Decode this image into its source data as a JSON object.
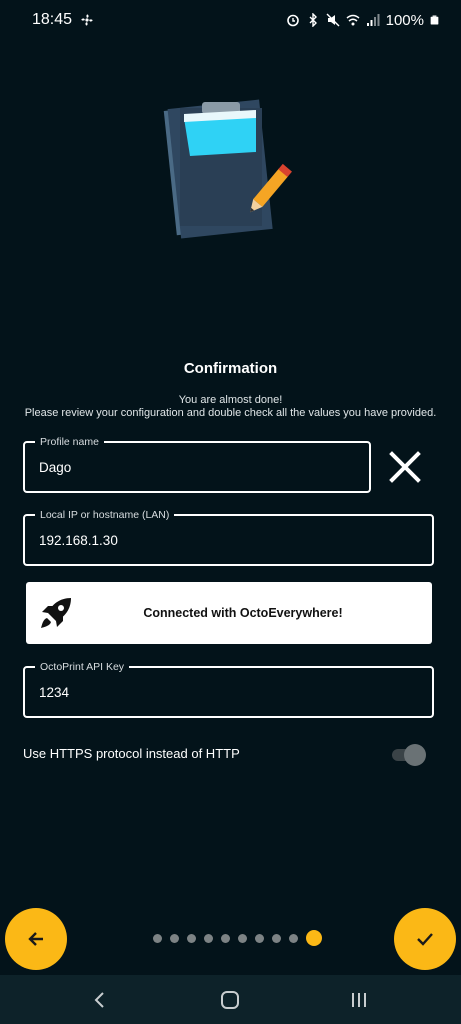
{
  "status_bar": {
    "time": "18:45",
    "battery": "100%",
    "icons": [
      "fan-icon",
      "alarm-icon",
      "bluetooth-icon",
      "mute-icon",
      "wifi-icon",
      "signal-icon",
      "battery-icon"
    ]
  },
  "header": {
    "title": "Confirmation",
    "subtitle_line1": "You are almost done!",
    "subtitle_line2": "Please review your configuration and double check all the values you have provided."
  },
  "form": {
    "profile_name": {
      "label": "Profile name",
      "value": "Dago"
    },
    "local_ip": {
      "label": "Local IP or hostname (LAN)",
      "value": "192.168.1.30"
    },
    "octo_everywhere": {
      "label": "Connected with OctoEverywhere!"
    },
    "api_key": {
      "label": "OctoPrint API Key",
      "value": "1234"
    },
    "https_toggle": {
      "label": "Use HTTPS protocol instead of HTTP",
      "state": "off"
    }
  },
  "pager": {
    "count": 10,
    "active_index": 9
  },
  "colors": {
    "background": "#03131a",
    "accent": "#fbb816",
    "card": "#ffffff"
  }
}
